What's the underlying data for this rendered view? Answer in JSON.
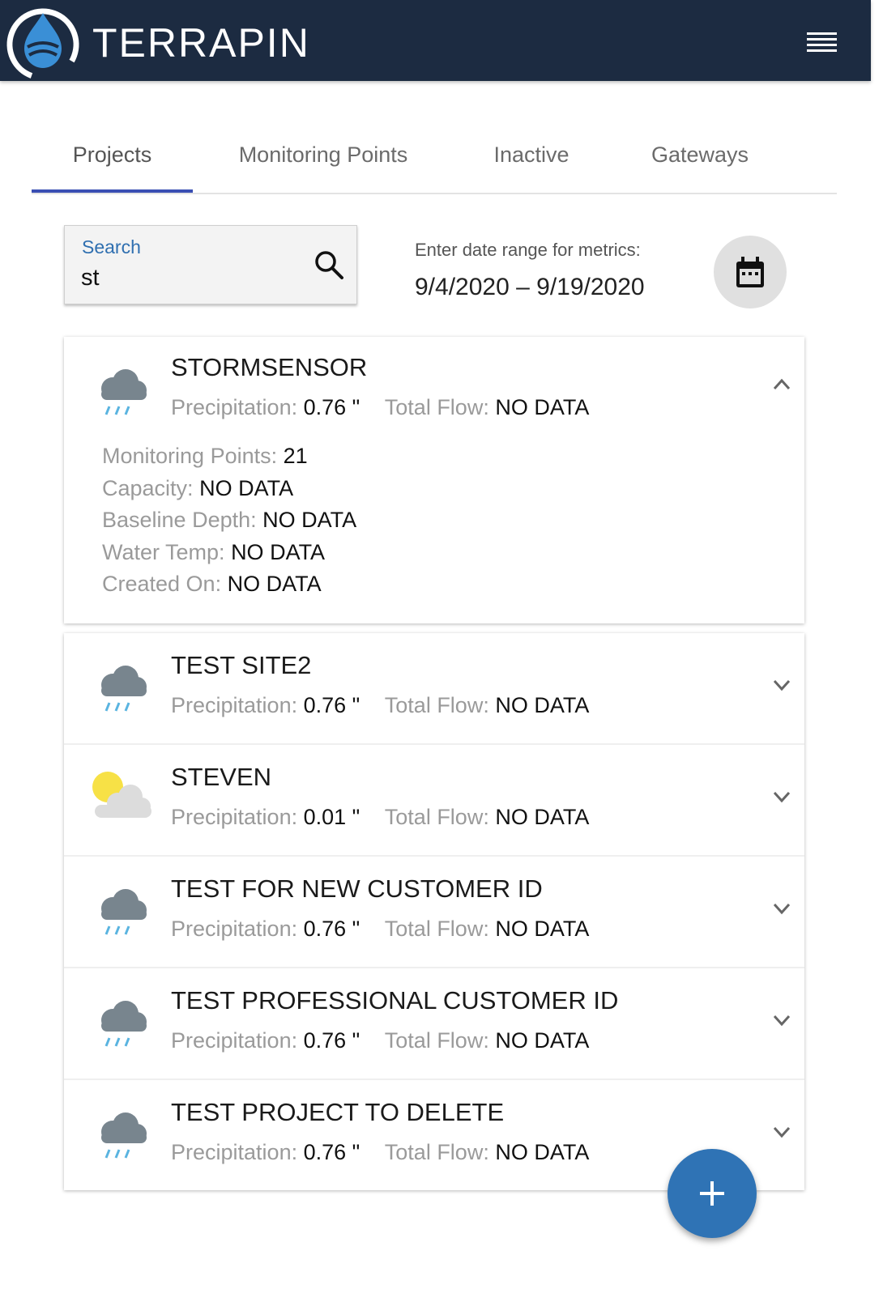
{
  "app": {
    "title": "TERRAPIN"
  },
  "tabs": [
    {
      "label": "Projects",
      "active": true
    },
    {
      "label": "Monitoring Points",
      "active": false
    },
    {
      "label": "Inactive",
      "active": false
    },
    {
      "label": "Gateways",
      "active": false
    }
  ],
  "search": {
    "label": "Search",
    "value": "st",
    "icon": "search-icon"
  },
  "date_range": {
    "label": "Enter date range for metrics:",
    "value": "9/4/2020 – 9/19/2020",
    "icon": "calendar-icon"
  },
  "labels": {
    "precipitation": "Precipitation:",
    "total_flow": "Total Flow:",
    "monitoring_points": "Monitoring Points:",
    "capacity": "Capacity:",
    "baseline_depth": "Baseline Depth:",
    "water_temp": "Water Temp:",
    "created_on": "Created On:"
  },
  "projects": [
    {
      "name": "STORMSENSOR",
      "weather": "rain-cloud-icon",
      "precipitation": "0.76 \"",
      "total_flow": "NO DATA",
      "expanded": true,
      "details": {
        "monitoring_points": "21",
        "capacity": "NO DATA",
        "baseline_depth": "NO DATA",
        "water_temp": "NO DATA",
        "created_on": "NO DATA"
      }
    },
    {
      "name": "TEST SITE2",
      "weather": "rain-cloud-icon",
      "precipitation": "0.76 \"",
      "total_flow": "NO DATA",
      "expanded": false
    },
    {
      "name": "STEVEN",
      "weather": "partly-sunny-icon",
      "precipitation": "0.01 \"",
      "total_flow": "NO DATA",
      "expanded": false
    },
    {
      "name": "TEST FOR NEW CUSTOMER ID",
      "weather": "rain-cloud-icon",
      "precipitation": "0.76 \"",
      "total_flow": "NO DATA",
      "expanded": false
    },
    {
      "name": "TEST PROFESSIONAL CUSTOMER ID",
      "weather": "rain-cloud-icon",
      "precipitation": "0.76 \"",
      "total_flow": "NO DATA",
      "expanded": false
    },
    {
      "name": "TEST PROJECT TO DELETE",
      "weather": "rain-cloud-icon",
      "precipitation": "0.76 \"",
      "total_flow": "NO DATA",
      "expanded": false
    }
  ],
  "fab": {
    "icon": "plus-icon"
  },
  "colors": {
    "header": "#1c2b41",
    "accent": "#2f73b5",
    "tab_indicator": "#3a4fb3"
  }
}
